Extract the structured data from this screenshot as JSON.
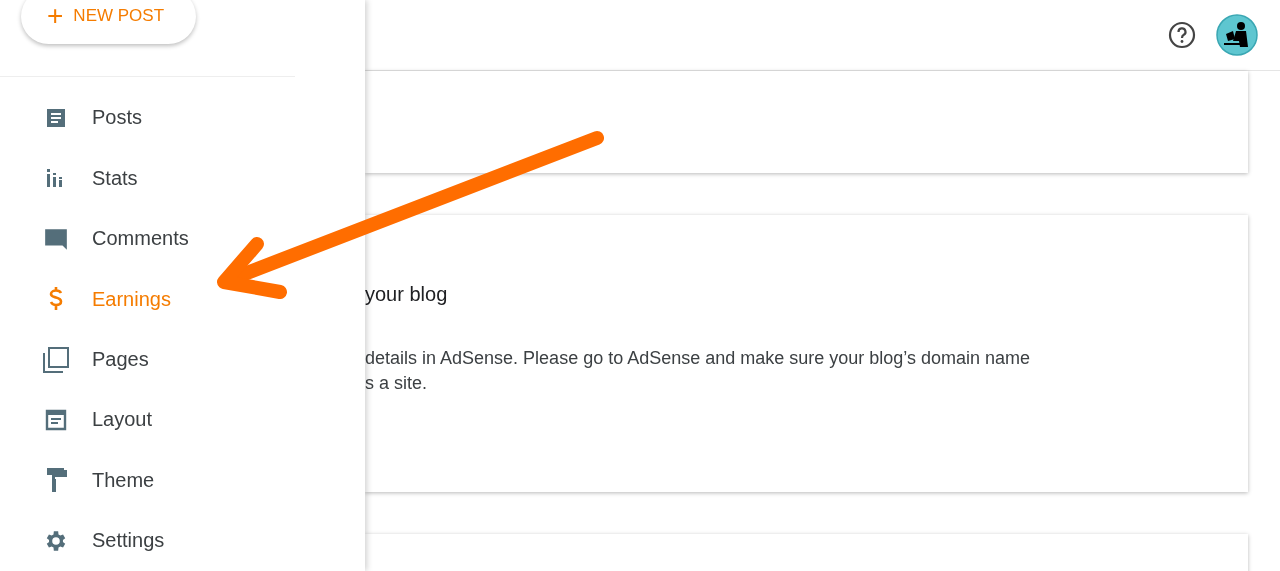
{
  "sidebar": {
    "new_post_button": {
      "icon": "+",
      "label": "NEW POST"
    },
    "items": [
      {
        "label": "Posts",
        "selected": false
      },
      {
        "label": "Stats",
        "selected": false
      },
      {
        "label": "Comments",
        "selected": false
      },
      {
        "label": "Earnings",
        "selected": true
      },
      {
        "label": "Pages",
        "selected": false
      },
      {
        "label": "Layout",
        "selected": false
      },
      {
        "label": "Theme",
        "selected": false
      },
      {
        "label": "Settings",
        "selected": false
      }
    ]
  },
  "cards": [
    {
      "kind": "blank"
    },
    {
      "kind": "message",
      "title": "your blog",
      "text_lines": [
        "details in AdSense. Please go to AdSense and make sure your blog’s domain name",
        "s a site."
      ]
    },
    {
      "kind": "blank"
    }
  ],
  "annotation": {
    "kind": "arrow",
    "color": "#ff6d00"
  }
}
